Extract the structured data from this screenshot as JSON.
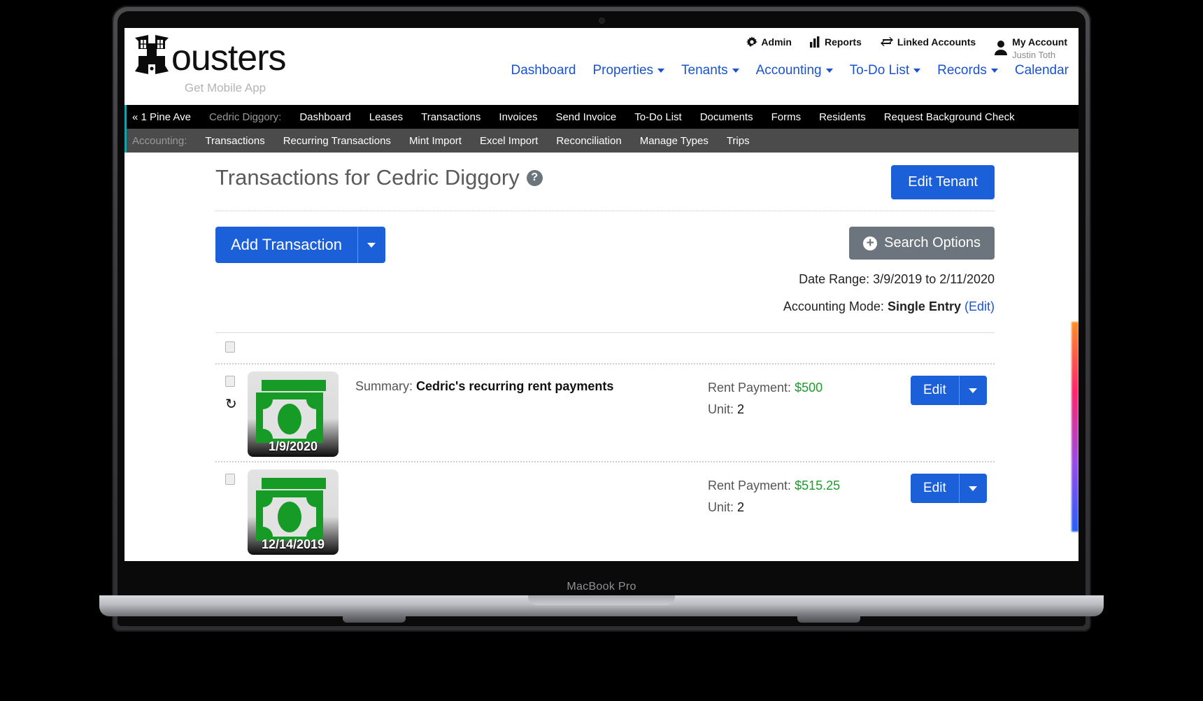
{
  "device": {
    "label": "MacBook Pro"
  },
  "brand": {
    "name": "ousters",
    "tagline": "Get Mobile App",
    "logo_letter": "H"
  },
  "top_utility": [
    {
      "name": "admin",
      "label": "Admin",
      "icon": "gear-icon"
    },
    {
      "name": "reports",
      "label": "Reports",
      "icon": "bar-chart-icon"
    },
    {
      "name": "linked-accounts",
      "label": "Linked Accounts",
      "icon": "exchange-arrows-icon"
    }
  ],
  "account": {
    "title": "My Account",
    "user": "Justin Toth",
    "icon": "user-icon"
  },
  "main_nav": [
    {
      "label": "Dashboard",
      "caret": false
    },
    {
      "label": "Properties",
      "caret": true
    },
    {
      "label": "Tenants",
      "caret": true
    },
    {
      "label": "Accounting",
      "caret": true
    },
    {
      "label": "To-Do List",
      "caret": true
    },
    {
      "label": "Records",
      "caret": true
    },
    {
      "label": "Calendar",
      "caret": false
    }
  ],
  "context_bar": {
    "back_label": "« 1 Pine Ave",
    "entity_label": "Cedric Diggory:",
    "items": [
      "Dashboard",
      "Leases",
      "Transactions",
      "Invoices",
      "Send Invoice",
      "To-Do List",
      "Documents",
      "Forms",
      "Residents",
      "Request Background Check"
    ]
  },
  "section_bar": {
    "label": "Accounting:",
    "items": [
      "Transactions",
      "Recurring Transactions",
      "Mint Import",
      "Excel Import",
      "Reconciliation",
      "Manage Types",
      "Trips"
    ]
  },
  "header": {
    "title": "Transactions for Cedric Diggory",
    "help_icon": "question-mark-icon",
    "edit_tenant_label": "Edit Tenant"
  },
  "toolbar": {
    "add_transaction_label": "Add Transaction",
    "search_options_label": "Search Options",
    "search_options_icon": "plus-circle-icon",
    "date_range_label": "Date Range: 3/9/2019 to 2/11/2020",
    "accounting_mode_label": "Accounting Mode:",
    "accounting_mode_value": "Single Entry",
    "accounting_mode_edit": "(Edit)"
  },
  "colors": {
    "primary": "#1b5fd9",
    "secondary": "#6c757d",
    "link": "#1a53cf",
    "money": "#1d9b2c",
    "accent_teal": "#16a0a8"
  },
  "transactions": [
    {
      "date": "1/9/2020",
      "recurring": true,
      "recurring_icon": "refresh-icon",
      "summary_label": "Summary:",
      "summary_value": "Cedric's recurring rent payments",
      "amount_label": "Rent Payment:",
      "amount_value": "$500",
      "unit_label": "Unit:",
      "unit_value": "2",
      "edit_label": "Edit",
      "thumb_icon": "money-stack-icon"
    },
    {
      "date": "12/14/2019",
      "recurring": false,
      "recurring_icon": "",
      "summary_label": "",
      "summary_value": "",
      "amount_label": "Rent Payment:",
      "amount_value": "$515.25",
      "unit_label": "Unit:",
      "unit_value": "2",
      "edit_label": "Edit",
      "thumb_icon": "money-stack-icon"
    }
  ]
}
